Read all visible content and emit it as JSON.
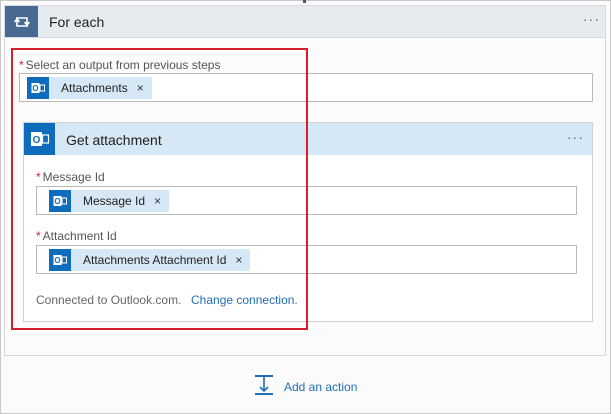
{
  "foreach": {
    "title": "For each",
    "menu": "···"
  },
  "select_output": {
    "required_mark": "*",
    "label": "Select an output from previous steps",
    "token": {
      "label": "Attachments",
      "remove": "×",
      "icon": "outlook-icon"
    }
  },
  "get_attachment": {
    "title": "Get attachment",
    "menu": "···",
    "icon": "outlook-icon",
    "message_id": {
      "required_mark": "*",
      "label": "Message Id",
      "token": {
        "label": "Message Id",
        "remove": "×",
        "icon": "outlook-icon"
      }
    },
    "attachment_id": {
      "required_mark": "*",
      "label": "Attachment Id",
      "token": {
        "label": "Attachments Attachment Id",
        "remove": "×",
        "icon": "outlook-icon"
      }
    },
    "connected_text": "Connected to Outlook.com.",
    "change_connection": "Change connection."
  },
  "add_action": {
    "label": "Add an action",
    "icon": "add-action-icon"
  },
  "colors": {
    "foreach_header": "#e6ebf0",
    "foreach_icon_bg": "#486991",
    "outlook_blue": "#0f6cbd",
    "token_bg": "#d6e7f5",
    "highlight_red": "#d41f2f",
    "link_blue": "#1f6fb5"
  }
}
